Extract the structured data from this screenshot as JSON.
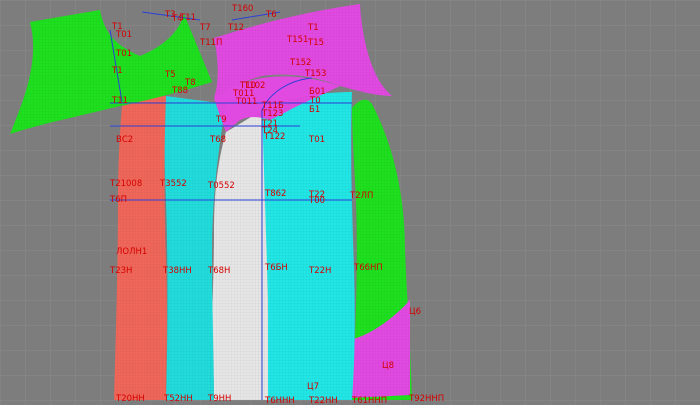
{
  "canvas": {
    "background": "#7d7d7d",
    "grid_color": "#8c8c8c"
  },
  "pieces": [
    {
      "id": "sleeve-green-left",
      "color": "#1fe01f"
    },
    {
      "id": "collar-magenta-top",
      "color": "#e14ae1"
    },
    {
      "id": "back-red",
      "color": "#f0675a"
    },
    {
      "id": "side-cyan",
      "color": "#22dcdc"
    },
    {
      "id": "side-white",
      "color": "#e6e6e6"
    },
    {
      "id": "front-cyan-wide",
      "color": "#22e6e6"
    },
    {
      "id": "side-green-right",
      "color": "#1fe01f"
    },
    {
      "id": "hem-magenta-right",
      "color": "#e14ae1"
    },
    {
      "id": "magenta-mid",
      "color": "#e14ae1"
    }
  ],
  "labels": [
    "T1",
    "T01",
    "T3",
    "T4",
    "T11",
    "T7",
    "T160",
    "T6",
    "T12",
    "T1",
    "T151",
    "T15",
    "T11П",
    "T152",
    "T153",
    "T5",
    "T8",
    "T88",
    "T1",
    "T01",
    "T11",
    "T10",
    "T102",
    "T011",
    "T011",
    "T11Б",
    "T0",
    "Б1",
    "Б01",
    "T123",
    "T9",
    "T24",
    "T122",
    "T21",
    "ВС2",
    "Т68",
    "Т01",
    "T21008",
    "T3552",
    "T0552",
    "T862",
    "T2ЛП",
    "T22",
    "Т00",
    "T6П",
    "ЛОЛН1",
    "T2ЗН",
    "T38НН",
    "T68Н",
    "T6БН",
    "T22Н",
    "T66НП",
    "Ц6",
    "Ц8",
    "Ц7",
    "T20НН",
    "T52НН",
    "T9НН",
    "T6ННН",
    "T22НН",
    "T61ННП",
    "T92ННП"
  ]
}
